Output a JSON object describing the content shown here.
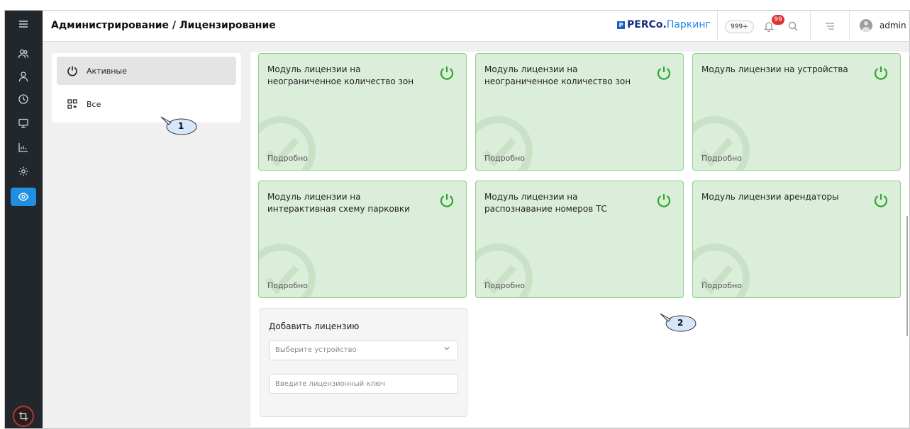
{
  "header": {
    "title": "Администрирование / Лицензирование",
    "brand_perco": "PERCo.",
    "brand_parking": "Паркинг",
    "badge": "999+",
    "notifications": "99",
    "user": "admin"
  },
  "left_menu": {
    "items": [
      {
        "label": "Активные",
        "icon": "power-icon"
      },
      {
        "label": "Все",
        "icon": "grid-plus-icon"
      }
    ]
  },
  "licenses": [
    {
      "title": "Модуль лицензии на неограниченное количество зон",
      "more": "Подробно"
    },
    {
      "title": "Модуль лицензии на неограниченное количество зон",
      "more": "Подробно"
    },
    {
      "title": "Модуль лицензии на устройства",
      "more": "Подробно"
    },
    {
      "title": "Модуль лицензии на интерактивная схему парковки",
      "more": "Подробно"
    },
    {
      "title": "Модуль лицензии на распознавание номеров ТС",
      "more": "Подробно"
    },
    {
      "title": "Модуль лицензии арендаторы",
      "more": "Подробно"
    }
  ],
  "add_license": {
    "title": "Добавить лицензию",
    "select_placeholder": "Выберите устройство",
    "key_placeholder": "Введите лицензионный ключ"
  },
  "callouts": [
    "1",
    "2"
  ],
  "colors": {
    "sidebar": "#22272b",
    "accent": "#1e8fe1",
    "card_bg": "#dbeeda",
    "card_border": "#8fcf8f",
    "power_green": "#2ea82e",
    "notif_red": "#e03131"
  }
}
